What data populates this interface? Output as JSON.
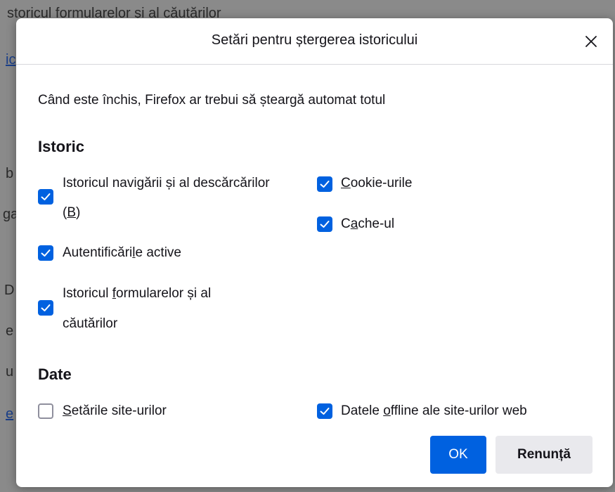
{
  "background": {
    "lines": [
      "storicul formularelor și al căutărilor",
      "ic",
      "b",
      "ga",
      "D",
      "e",
      "u",
      "e"
    ]
  },
  "dialog": {
    "title": "Setări pentru ștergerea istoricului",
    "close_icon": "close-icon",
    "intro": "Când este închis, Firefox ar trebui să șteargă automat totul",
    "sections": {
      "istoric": {
        "title": "Istoric",
        "items": {
          "browsing": {
            "pre": "Istoricul navigării și al descărcărilor",
            "line2_pre": "(",
            "line2_key": "B",
            "line2_post": ")",
            "checked": true
          },
          "logins": {
            "pre": "Autentificări",
            "key": "l",
            "post": "e active",
            "checked": true
          },
          "forms": {
            "line1_pre": "Istoricul ",
            "line1_key": "f",
            "line1_post": "ormularelor și al",
            "line2": "căutărilor",
            "checked": true
          },
          "cookies": {
            "key": "C",
            "post": "ookie-urile",
            "checked": true
          },
          "cache": {
            "pre": "C",
            "key": "a",
            "post": "che-ul",
            "checked": true
          }
        }
      },
      "date": {
        "title": "Date",
        "items": {
          "site_settings": {
            "key": "S",
            "post": "etările site-urilor",
            "checked": false
          },
          "offline": {
            "pre": "Datele ",
            "key": "o",
            "post": "ffline ale site-urilor web",
            "checked": true
          }
        }
      }
    },
    "buttons": {
      "ok": "OK",
      "cancel_pre": "Renun",
      "cancel_key": "ț",
      "cancel_post": "ă"
    }
  },
  "colors": {
    "accent": "#0061e0",
    "checkbox_border": "#8f8f9d",
    "secondary_button": "#e9e9ed"
  }
}
